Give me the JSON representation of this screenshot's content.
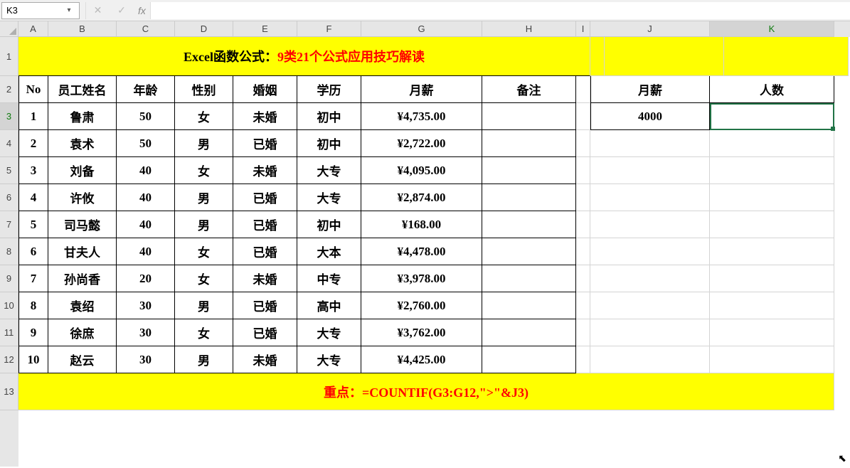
{
  "nameBox": "K3",
  "fx_label": "fx",
  "formula": "",
  "columns": [
    "A",
    "B",
    "C",
    "D",
    "E",
    "F",
    "G",
    "H",
    "I",
    "J",
    "K"
  ],
  "selectedCol": "K",
  "selectedRow": "3",
  "title": {
    "prefix": "Excel函数公式：",
    "highlight": "9类21个公式应用技巧解读"
  },
  "headers": {
    "no": "No",
    "name": "员工姓名",
    "age": "年龄",
    "gender": "性别",
    "marital": "婚姻",
    "edu": "学历",
    "salary": "月薪",
    "note": "备注"
  },
  "side_headers": {
    "salary": "月薪",
    "count": "人数"
  },
  "side_value": "4000",
  "rows": [
    {
      "no": "1",
      "name": "鲁肃",
      "age": "50",
      "gender": "女",
      "marital": "未婚",
      "edu": "初中",
      "salary": "¥4,735.00"
    },
    {
      "no": "2",
      "name": "袁术",
      "age": "50",
      "gender": "男",
      "marital": "已婚",
      "edu": "初中",
      "salary": "¥2,722.00"
    },
    {
      "no": "3",
      "name": "刘备",
      "age": "40",
      "gender": "女",
      "marital": "未婚",
      "edu": "大专",
      "salary": "¥4,095.00"
    },
    {
      "no": "4",
      "name": "许攸",
      "age": "40",
      "gender": "男",
      "marital": "已婚",
      "edu": "大专",
      "salary": "¥2,874.00"
    },
    {
      "no": "5",
      "name": "司马懿",
      "age": "40",
      "gender": "男",
      "marital": "已婚",
      "edu": "初中",
      "salary": "¥168.00"
    },
    {
      "no": "6",
      "name": "甘夫人",
      "age": "40",
      "gender": "女",
      "marital": "已婚",
      "edu": "大本",
      "salary": "¥4,478.00"
    },
    {
      "no": "7",
      "name": "孙尚香",
      "age": "20",
      "gender": "女",
      "marital": "未婚",
      "edu": "中专",
      "salary": "¥3,978.00"
    },
    {
      "no": "8",
      "name": "袁绍",
      "age": "30",
      "gender": "男",
      "marital": "已婚",
      "edu": "高中",
      "salary": "¥2,760.00"
    },
    {
      "no": "9",
      "name": "徐庶",
      "age": "30",
      "gender": "女",
      "marital": "已婚",
      "edu": "大专",
      "salary": "¥3,762.00"
    },
    {
      "no": "10",
      "name": "赵云",
      "age": "30",
      "gender": "男",
      "marital": "未婚",
      "edu": "大专",
      "salary": "¥4,425.00"
    }
  ],
  "footer": "重点：=COUNTIF(G3:G12,\">\"&J3)",
  "chart_data": {
    "type": "table",
    "title": "Excel函数公式：9类21个公式应用技巧解读",
    "columns": [
      "No",
      "员工姓名",
      "年龄",
      "性别",
      "婚姻",
      "学历",
      "月薪",
      "备注"
    ],
    "rows": [
      [
        1,
        "鲁肃",
        50,
        "女",
        "未婚",
        "初中",
        4735.0,
        ""
      ],
      [
        2,
        "袁术",
        50,
        "男",
        "已婚",
        "初中",
        2722.0,
        ""
      ],
      [
        3,
        "刘备",
        40,
        "女",
        "未婚",
        "大专",
        4095.0,
        ""
      ],
      [
        4,
        "许攸",
        40,
        "男",
        "已婚",
        "大专",
        2874.0,
        ""
      ],
      [
        5,
        "司马懿",
        40,
        "男",
        "已婚",
        "初中",
        168.0,
        ""
      ],
      [
        6,
        "甘夫人",
        40,
        "女",
        "已婚",
        "大本",
        4478.0,
        ""
      ],
      [
        7,
        "孙尚香",
        20,
        "女",
        "未婚",
        "中专",
        3978.0,
        ""
      ],
      [
        8,
        "袁绍",
        30,
        "男",
        "已婚",
        "高中",
        2760.0,
        ""
      ],
      [
        9,
        "徐庶",
        30,
        "女",
        "已婚",
        "大专",
        3762.0,
        ""
      ],
      [
        10,
        "赵云",
        30,
        "男",
        "未婚",
        "大专",
        4425.0,
        ""
      ]
    ],
    "side_table": {
      "月薪": 4000,
      "人数": null
    },
    "formula_note": "=COUNTIF(G3:G12,\">\"&J3)"
  }
}
